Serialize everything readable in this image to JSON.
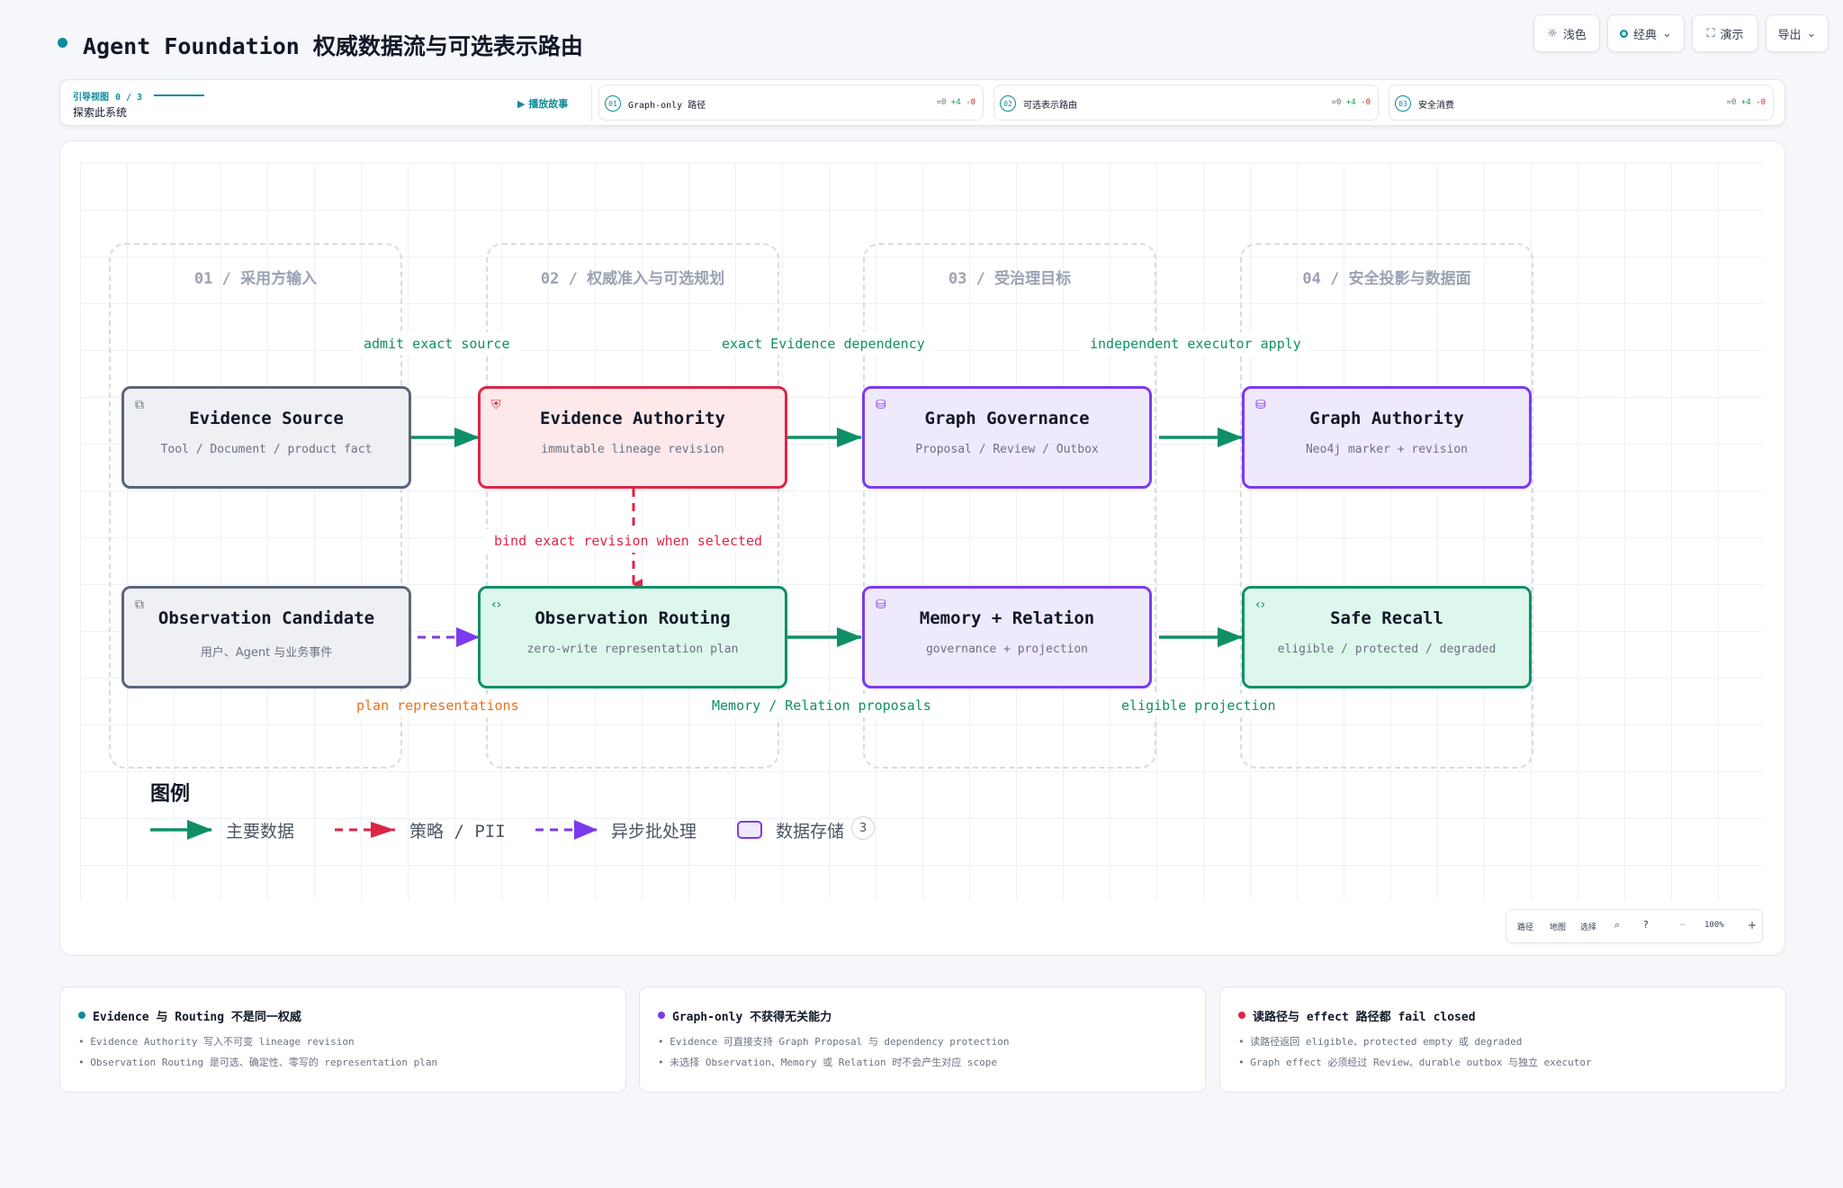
{
  "header": {
    "title": "Agent Foundation 权威数据流与可选表示路由",
    "buttons": {
      "theme": "浅色",
      "style": "经典",
      "present": "演示",
      "export": "导出"
    }
  },
  "story": {
    "guide_label": "引导视图",
    "guide_progress": "0 / 3",
    "guide_sub": "探索此系统",
    "play": "播放故事",
    "steps": [
      {
        "num": "01",
        "label": "Graph-only 路径",
        "diff0": "=0",
        "diffp": "+4",
        "diffm": "-0"
      },
      {
        "num": "02",
        "label": "可选表示路由",
        "diff0": "=0",
        "diffp": "+4",
        "diffm": "-0"
      },
      {
        "num": "03",
        "label": "安全消费",
        "diff0": "=0",
        "diffp": "+4",
        "diffm": "-0"
      }
    ]
  },
  "diagram": {
    "lanes": [
      "01 / 采用方输入",
      "02 / 权威准入与可选规划",
      "03 / 受治理目标",
      "04 / 安全投影与数据面"
    ],
    "nodes": {
      "evidence_source": {
        "title": "Evidence Source",
        "sub": "Tool / Document / product fact",
        "icon": "external-link-icon"
      },
      "evidence_authority": {
        "title": "Evidence Authority",
        "sub": "immutable lineage revision",
        "icon": "shield-icon"
      },
      "graph_governance": {
        "title": "Graph Governance",
        "sub": "Proposal / Review / Outbox",
        "icon": "database-icon"
      },
      "graph_authority": {
        "title": "Graph Authority",
        "sub": "Neo4j marker + revision",
        "icon": "database-icon"
      },
      "observation_candidate": {
        "title": "Observation Candidate",
        "sub": "用户、Agent 与业务事件",
        "icon": "external-link-icon"
      },
      "observation_routing": {
        "title": "Observation Routing",
        "sub": "zero-write representation plan",
        "icon": "code-icon"
      },
      "memory_relation": {
        "title": "Memory + Relation",
        "sub": "governance + projection",
        "icon": "database-icon"
      },
      "safe_recall": {
        "title": "Safe Recall",
        "sub": "eligible / protected / degraded",
        "icon": "code-icon"
      }
    },
    "edge_labels": {
      "admit": "admit exact source",
      "exact_dep": "exact Evidence dependency",
      "executor": "independent executor apply",
      "bind": "bind exact revision when selected",
      "plan": "plan representations",
      "proposals": "Memory / Relation proposals",
      "eligible": "eligible projection"
    },
    "colors": {
      "primary": "#0f8f66",
      "policy": "#dc2646",
      "async": "#7c3aed",
      "plan_label": "#e8711c"
    }
  },
  "legend": {
    "title": "图例",
    "primary": "主要数据",
    "policy": "策略 / PII",
    "async": "异步批处理",
    "store": "数据存储",
    "store_count": "3"
  },
  "zoom": {
    "path": "路径",
    "map": "地图",
    "select": "选择",
    "level": "100%",
    "minus": "−",
    "plus": "+"
  },
  "cards": [
    {
      "title": "Evidence 与 Routing 不是同一权威",
      "dot": "#0e8a9c",
      "lines": [
        "Evidence Authority 写入不可变 lineage revision",
        "Observation Routing 是可选、确定性、零写的 representation plan"
      ]
    },
    {
      "title": "Graph-only 不获得无关能力",
      "dot": "#7c3aed",
      "lines": [
        "Evidence 可直接支持 Graph Proposal 与 dependency protection",
        "未选择 Observation、Memory 或 Relation 时不会产生对应 scope"
      ]
    },
    {
      "title": "读路径与 effect 路径都 fail closed",
      "dot": "#dc2646",
      "lines": [
        "读路径返回 eligible、protected empty 或 degraded",
        "Graph effect 必须经过 Review、durable outbox 与独立 executor"
      ]
    }
  ]
}
